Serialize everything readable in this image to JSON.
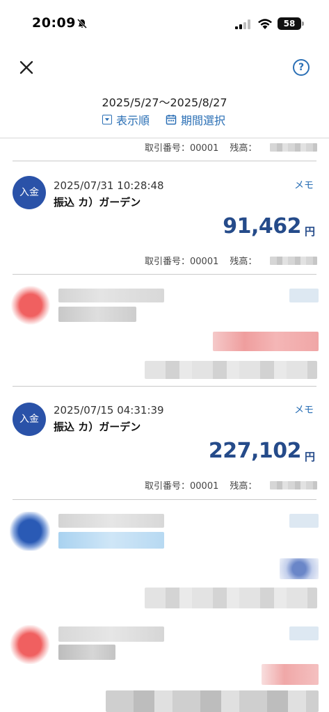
{
  "status": {
    "time": "20:09",
    "battery": "58"
  },
  "header": {
    "period": "2025/5/27〜2025/8/27",
    "sort_label": "表示順",
    "period_select_label": "期間選択",
    "help_label": "?"
  },
  "top_meta": {
    "tx_no_label": "取引番号：00001",
    "balance_label": "残高："
  },
  "transactions": [
    {
      "badge": "入金",
      "datetime": "2025/07/31 10:28:48",
      "name": "振込 カ）ガーデン",
      "memo": "メモ",
      "amount": "91,462",
      "yen": "円",
      "tx_no_label": "取引番号：00001",
      "balance_label": "残高："
    },
    {
      "badge": "入金",
      "datetime": "2025/07/15 04:31:39",
      "name": "振込 カ）ガーデン",
      "memo": "メモ",
      "amount": "227,102",
      "yen": "円",
      "tx_no_label": "取引番号：00001",
      "balance_label": "残高："
    }
  ],
  "colors": {
    "accent": "#2a6fb5",
    "amount": "#254b8a",
    "badge": "#2a52a8"
  }
}
